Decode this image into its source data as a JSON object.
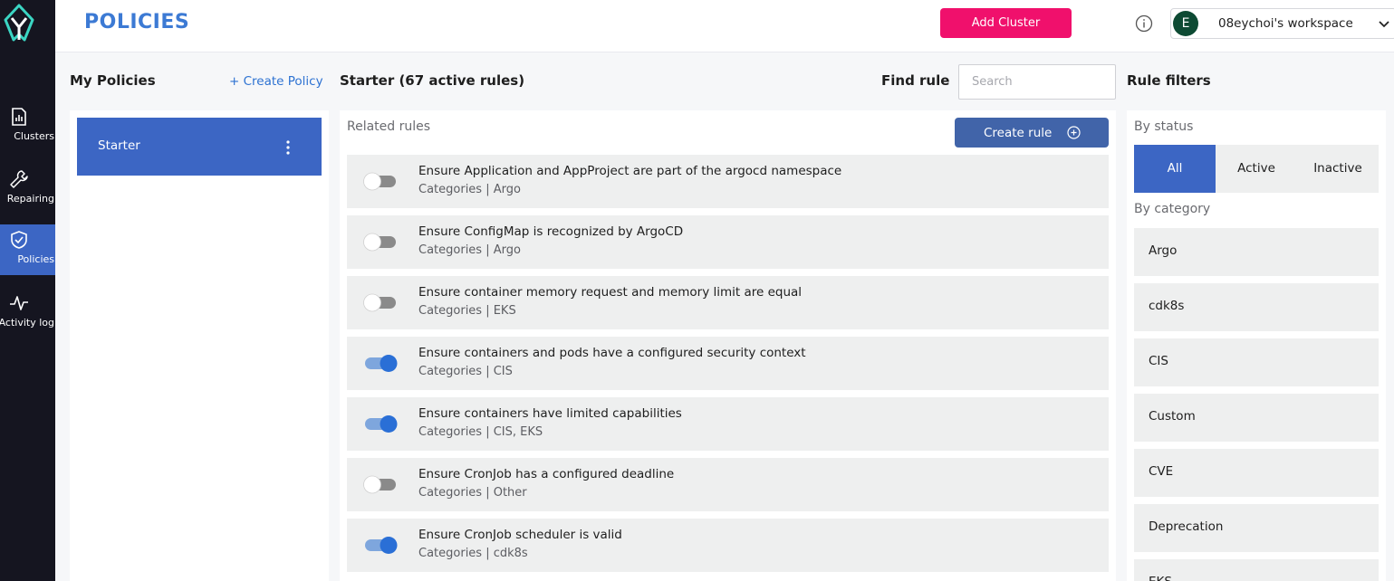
{
  "nav": {
    "items": [
      {
        "label": "Clusters",
        "icon": "clusters-icon",
        "active": false
      },
      {
        "label": "Repairing",
        "icon": "wrench-icon",
        "active": false
      },
      {
        "label": "Policies",
        "icon": "shield-icon",
        "active": true
      },
      {
        "label": "Activity log",
        "icon": "activity-icon",
        "active": false
      }
    ]
  },
  "header": {
    "title": "POLICIES",
    "add_cluster_label": "Add Cluster",
    "workspace_initial": "E",
    "workspace_name": "08eychoi's workspace"
  },
  "policies": {
    "heading": "My Policies",
    "create_label": "+ Create Policy",
    "items": [
      {
        "name": "Starter"
      }
    ]
  },
  "rules": {
    "heading": "Starter (67 active rules)",
    "find_label": "Find rule",
    "search_placeholder": "Search",
    "related_label": "Related rules",
    "create_rule_label": "Create rule",
    "items": [
      {
        "title": "Ensure Application and AppProject are part of the argocd namespace",
        "categories": "Categories | Argo",
        "enabled": false
      },
      {
        "title": "Ensure ConfigMap is recognized by ArgoCD",
        "categories": "Categories | Argo",
        "enabled": false
      },
      {
        "title": "Ensure container memory request and memory limit are equal",
        "categories": "Categories | EKS",
        "enabled": false
      },
      {
        "title": "Ensure containers and pods have a configured security context",
        "categories": "Categories | CIS",
        "enabled": true
      },
      {
        "title": "Ensure containers have limited capabilities",
        "categories": "Categories | CIS, EKS",
        "enabled": true
      },
      {
        "title": "Ensure CronJob has a configured deadline",
        "categories": "Categories | Other",
        "enabled": false
      },
      {
        "title": "Ensure CronJob scheduler is valid",
        "categories": "Categories | cdk8s",
        "enabled": true
      }
    ]
  },
  "filters": {
    "heading": "Rule filters",
    "status_label": "By status",
    "statuses": [
      "All",
      "Active",
      "Inactive"
    ],
    "selected_status": "All",
    "category_label": "By category",
    "categories": [
      "Argo",
      "cdk8s",
      "CIS",
      "Custom",
      "CVE",
      "Deprecation",
      "EKS"
    ]
  },
  "colors": {
    "accent": "#3c66c4",
    "brand_pink": "#f0106c",
    "nav_bg": "#151520",
    "toggle_on": "#2a6fd6"
  }
}
